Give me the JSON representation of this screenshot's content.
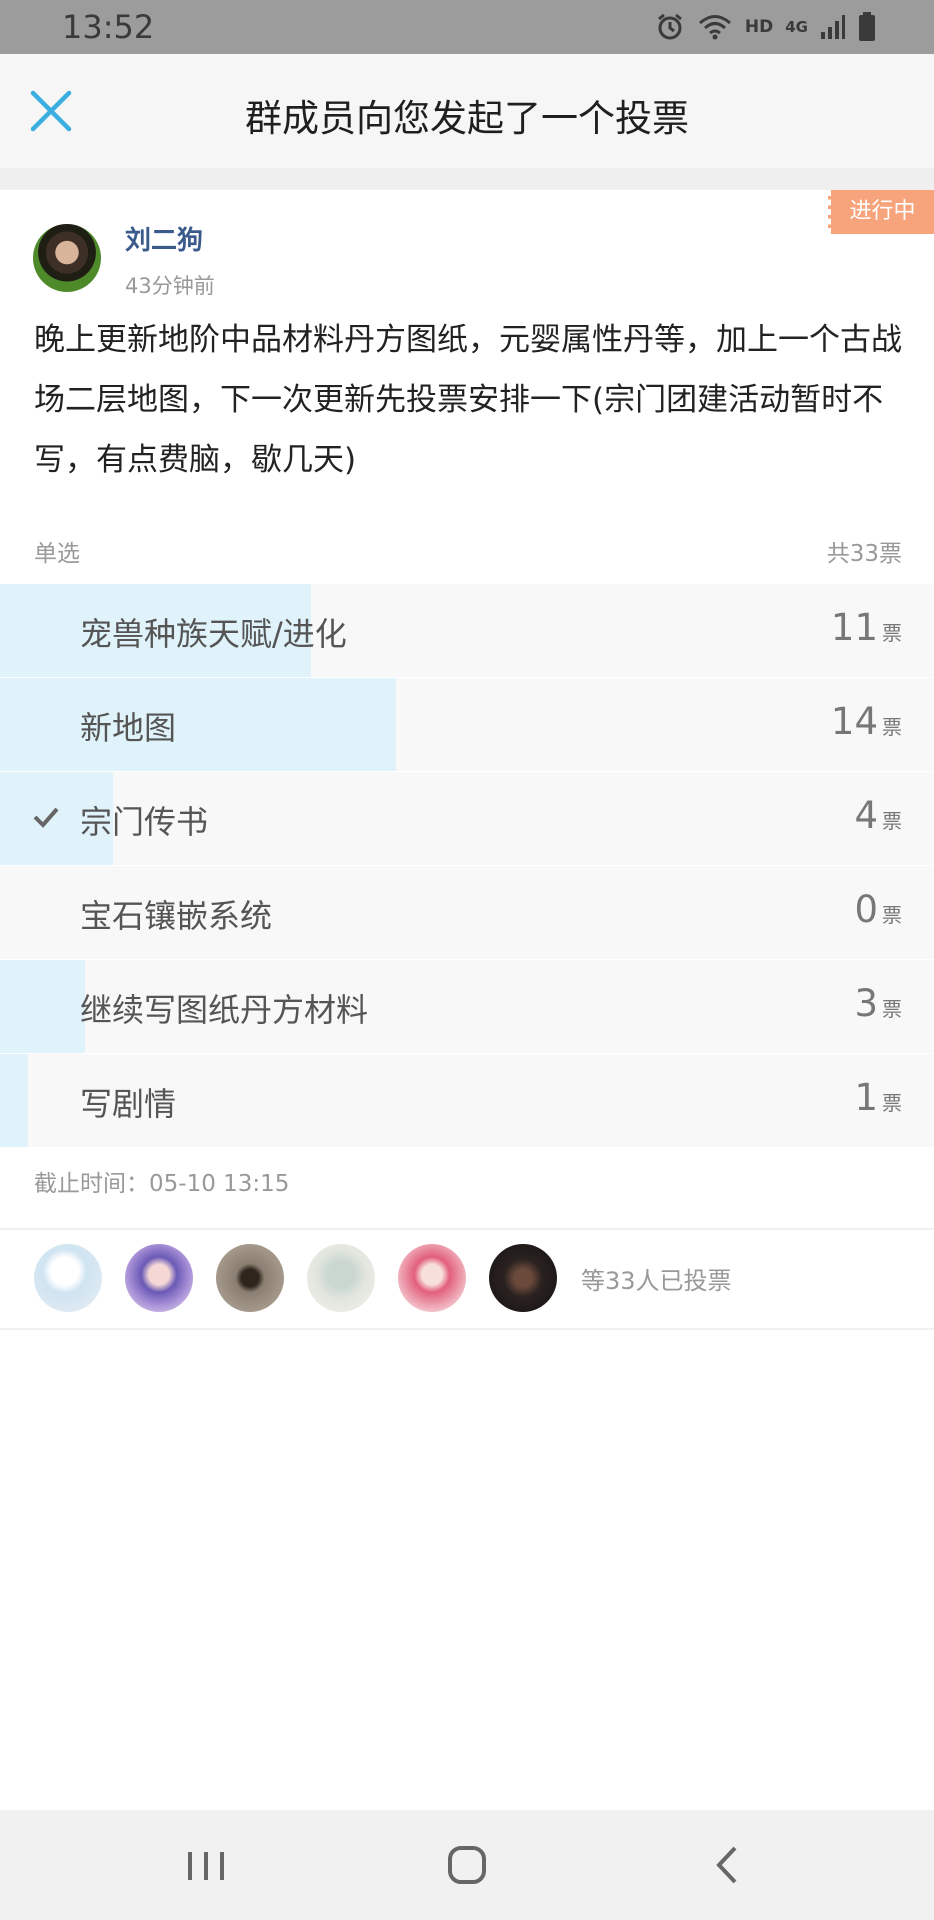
{
  "status_bar": {
    "time": "13:52",
    "network_hd": "HD",
    "network_type": "4G"
  },
  "header": {
    "title": "群成员向您发起了一个投票"
  },
  "poll": {
    "status": "进行中",
    "author": "刘二狗",
    "time_ago": "43分钟前",
    "content": "晚上更新地阶中品材料丹方图纸，元婴属性丹等，加上一个古战场二层地图，下一次更新先投票安排一下(宗门团建活动暂时不写，有点费脑，歇几天)",
    "vote_type": "单选",
    "total": "共33票",
    "vote_unit": "票",
    "options": [
      {
        "label": "宠兽种族天赋/进化",
        "votes": 11,
        "fill": 0.333,
        "selected": false
      },
      {
        "label": "新地图",
        "votes": 14,
        "fill": 0.424,
        "selected": false
      },
      {
        "label": "宗门传书",
        "votes": 4,
        "fill": 0.121,
        "selected": true
      },
      {
        "label": "宝石镶嵌系统",
        "votes": 0,
        "fill": 0.0,
        "selected": false
      },
      {
        "label": "继续写图纸丹方材料",
        "votes": 3,
        "fill": 0.091,
        "selected": false
      },
      {
        "label": "写剧情",
        "votes": 1,
        "fill": 0.03,
        "selected": false
      }
    ],
    "deadline": "截止时间：05-10 13:15",
    "voters_summary": "等33人已投票"
  },
  "colors": {
    "accent": "#3aaee0",
    "bar_fill": "#e0f3fb",
    "badge": "#f7a37c",
    "author": "#3a5a8c"
  }
}
